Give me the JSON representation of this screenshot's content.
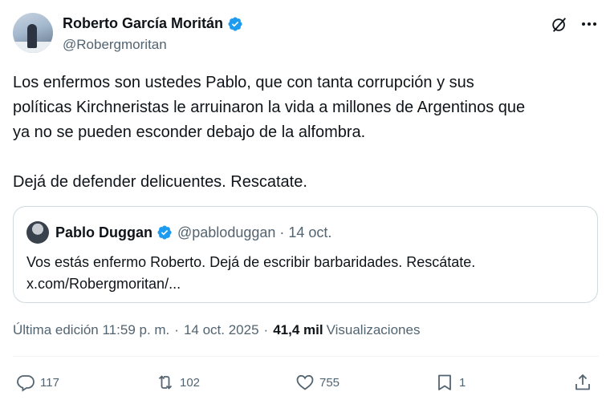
{
  "author": {
    "name": "Roberto García Moritán",
    "handle": "@Robergmoritan",
    "verified": true
  },
  "tweet": {
    "text": "Los enfermos son ustedes Pablo, que con tanta corrupción y sus\npolíticas Kirchneristas le arruinaron la vida a millones de Argentinos que\nya no se pueden esconder debajo de la alfombra.\n\nDejá de defender delicuentes. Rescatate."
  },
  "quote": {
    "name": "Pablo Duggan",
    "handle": "@pabloduggan",
    "date": "· 14 oct.",
    "text_line1": "Vos estás enfermo Roberto. Dejá de escribir barbaridades. Rescátate.",
    "text_line2": "x.com/Robergmoritan/..."
  },
  "meta": {
    "edited_label": "Última edición 11:59 p. m.",
    "separator": "·",
    "date": "14 oct. 2025",
    "views_count": "41,4 mil",
    "views_label": "Visualizaciones"
  },
  "actions": {
    "replies": "117",
    "reposts": "102",
    "likes": "755",
    "bookmarks": "1"
  },
  "colors": {
    "verified_blue": "#1d9bf0",
    "text_primary": "#0f1419",
    "text_secondary": "#536471",
    "border": "#cfd9de"
  },
  "icons": [
    "grok-icon",
    "more-icon",
    "verified-icon",
    "reply-icon",
    "repost-icon",
    "like-icon",
    "bookmark-icon",
    "share-icon"
  ]
}
